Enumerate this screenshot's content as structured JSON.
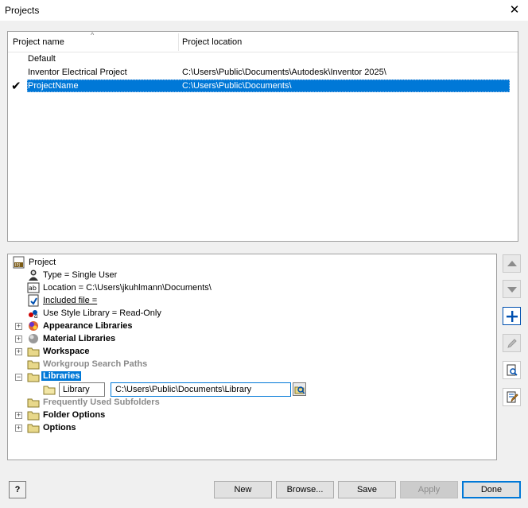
{
  "window": {
    "title": "Projects",
    "close_glyph": "✕"
  },
  "projects": {
    "columns": {
      "name": "Project name",
      "location": "Project location"
    },
    "rows": [
      {
        "name": "Default",
        "location": ""
      },
      {
        "name": "Inventor Electrical Project",
        "location": "C:\\Users\\Public\\Documents\\Autodesk\\Inventor 2025\\"
      },
      {
        "name": "ProjectName",
        "location": "C:\\Users\\Public\\Documents\\",
        "active": true,
        "selected": true
      }
    ]
  },
  "tree": {
    "root": "Project",
    "type": "Type = Single User",
    "location": "Location = C:\\Users\\jkuhlmann\\Documents\\",
    "included_file": "Included file =",
    "use_style": "Use Style Library = Read-Only",
    "appearance": "Appearance Libraries",
    "material": "Material Libraries",
    "workspace": "Workspace",
    "workgroup": "Workgroup Search Paths",
    "libraries": "Libraries",
    "library_entry": {
      "name": "Library",
      "path": "C:\\Users\\Public\\Documents\\Library"
    },
    "frequent": "Frequently Used Subfolders",
    "folder_options": "Folder Options",
    "options": "Options"
  },
  "buttons": {
    "new": "New",
    "browse": "Browse...",
    "save": "Save",
    "apply": "Apply",
    "done": "Done",
    "help": "?"
  },
  "colors": {
    "selection": "#0078d7",
    "accent_blue": "#0050b0",
    "folder_yellow": "#e8d88a"
  }
}
